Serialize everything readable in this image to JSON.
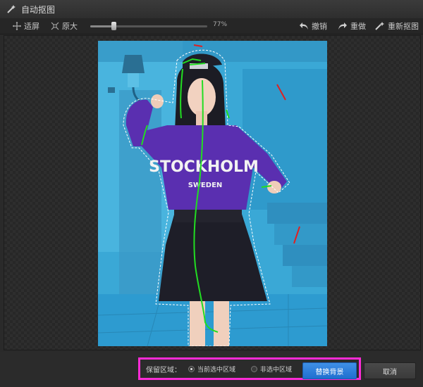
{
  "window": {
    "title": "自动抠图"
  },
  "toolbar": {
    "fit_label": "适屏",
    "original_label": "原大",
    "zoom_percent": "77%",
    "zoom_fraction": 0.2,
    "undo_label": "撤销",
    "redo_label": "重做",
    "recut_label": "重新抠图"
  },
  "photo": {
    "shirt_text": "STOCKHOLM",
    "shirt_subtext": "SWEDEN",
    "keep_stroke_color": "#22dd22",
    "remove_stroke_color": "#e02020",
    "tint_color": "#3aa8d6"
  },
  "bottom": {
    "keep_area_label": "保留区域：",
    "option_current": "当前选中区域",
    "option_unselected": "非选中区域",
    "replace_bg_label": "替换背景",
    "cancel_label": "取消",
    "highlight_color": "#ff2bd6"
  }
}
